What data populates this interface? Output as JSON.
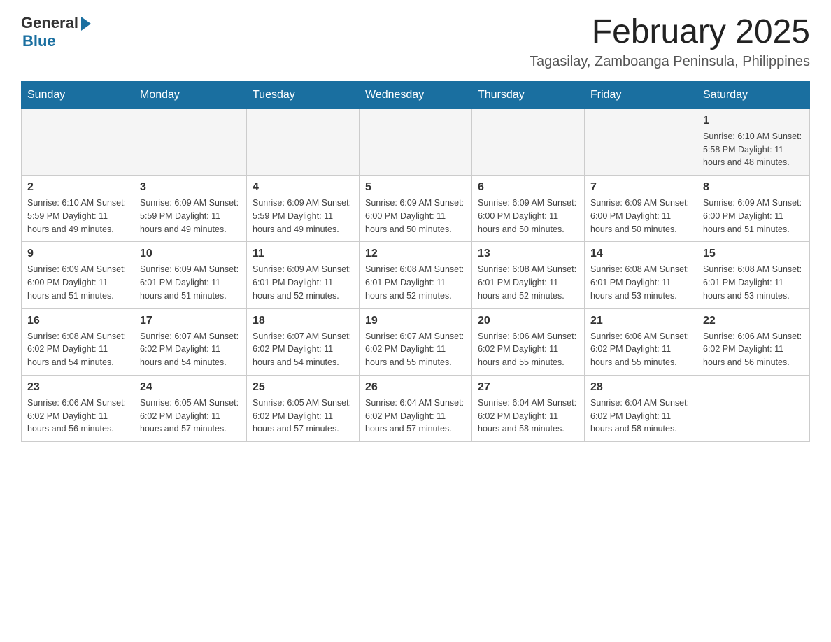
{
  "logo": {
    "general": "General",
    "blue": "Blue"
  },
  "title": "February 2025",
  "subtitle": "Tagasilay, Zamboanga Peninsula, Philippines",
  "days_of_week": [
    "Sunday",
    "Monday",
    "Tuesday",
    "Wednesday",
    "Thursday",
    "Friday",
    "Saturday"
  ],
  "weeks": [
    [
      {
        "day": "",
        "info": ""
      },
      {
        "day": "",
        "info": ""
      },
      {
        "day": "",
        "info": ""
      },
      {
        "day": "",
        "info": ""
      },
      {
        "day": "",
        "info": ""
      },
      {
        "day": "",
        "info": ""
      },
      {
        "day": "1",
        "info": "Sunrise: 6:10 AM\nSunset: 5:58 PM\nDaylight: 11 hours and 48 minutes."
      }
    ],
    [
      {
        "day": "2",
        "info": "Sunrise: 6:10 AM\nSunset: 5:59 PM\nDaylight: 11 hours and 49 minutes."
      },
      {
        "day": "3",
        "info": "Sunrise: 6:09 AM\nSunset: 5:59 PM\nDaylight: 11 hours and 49 minutes."
      },
      {
        "day": "4",
        "info": "Sunrise: 6:09 AM\nSunset: 5:59 PM\nDaylight: 11 hours and 49 minutes."
      },
      {
        "day": "5",
        "info": "Sunrise: 6:09 AM\nSunset: 6:00 PM\nDaylight: 11 hours and 50 minutes."
      },
      {
        "day": "6",
        "info": "Sunrise: 6:09 AM\nSunset: 6:00 PM\nDaylight: 11 hours and 50 minutes."
      },
      {
        "day": "7",
        "info": "Sunrise: 6:09 AM\nSunset: 6:00 PM\nDaylight: 11 hours and 50 minutes."
      },
      {
        "day": "8",
        "info": "Sunrise: 6:09 AM\nSunset: 6:00 PM\nDaylight: 11 hours and 51 minutes."
      }
    ],
    [
      {
        "day": "9",
        "info": "Sunrise: 6:09 AM\nSunset: 6:00 PM\nDaylight: 11 hours and 51 minutes."
      },
      {
        "day": "10",
        "info": "Sunrise: 6:09 AM\nSunset: 6:01 PM\nDaylight: 11 hours and 51 minutes."
      },
      {
        "day": "11",
        "info": "Sunrise: 6:09 AM\nSunset: 6:01 PM\nDaylight: 11 hours and 52 minutes."
      },
      {
        "day": "12",
        "info": "Sunrise: 6:08 AM\nSunset: 6:01 PM\nDaylight: 11 hours and 52 minutes."
      },
      {
        "day": "13",
        "info": "Sunrise: 6:08 AM\nSunset: 6:01 PM\nDaylight: 11 hours and 52 minutes."
      },
      {
        "day": "14",
        "info": "Sunrise: 6:08 AM\nSunset: 6:01 PM\nDaylight: 11 hours and 53 minutes."
      },
      {
        "day": "15",
        "info": "Sunrise: 6:08 AM\nSunset: 6:01 PM\nDaylight: 11 hours and 53 minutes."
      }
    ],
    [
      {
        "day": "16",
        "info": "Sunrise: 6:08 AM\nSunset: 6:02 PM\nDaylight: 11 hours and 54 minutes."
      },
      {
        "day": "17",
        "info": "Sunrise: 6:07 AM\nSunset: 6:02 PM\nDaylight: 11 hours and 54 minutes."
      },
      {
        "day": "18",
        "info": "Sunrise: 6:07 AM\nSunset: 6:02 PM\nDaylight: 11 hours and 54 minutes."
      },
      {
        "day": "19",
        "info": "Sunrise: 6:07 AM\nSunset: 6:02 PM\nDaylight: 11 hours and 55 minutes."
      },
      {
        "day": "20",
        "info": "Sunrise: 6:06 AM\nSunset: 6:02 PM\nDaylight: 11 hours and 55 minutes."
      },
      {
        "day": "21",
        "info": "Sunrise: 6:06 AM\nSunset: 6:02 PM\nDaylight: 11 hours and 55 minutes."
      },
      {
        "day": "22",
        "info": "Sunrise: 6:06 AM\nSunset: 6:02 PM\nDaylight: 11 hours and 56 minutes."
      }
    ],
    [
      {
        "day": "23",
        "info": "Sunrise: 6:06 AM\nSunset: 6:02 PM\nDaylight: 11 hours and 56 minutes."
      },
      {
        "day": "24",
        "info": "Sunrise: 6:05 AM\nSunset: 6:02 PM\nDaylight: 11 hours and 57 minutes."
      },
      {
        "day": "25",
        "info": "Sunrise: 6:05 AM\nSunset: 6:02 PM\nDaylight: 11 hours and 57 minutes."
      },
      {
        "day": "26",
        "info": "Sunrise: 6:04 AM\nSunset: 6:02 PM\nDaylight: 11 hours and 57 minutes."
      },
      {
        "day": "27",
        "info": "Sunrise: 6:04 AM\nSunset: 6:02 PM\nDaylight: 11 hours and 58 minutes."
      },
      {
        "day": "28",
        "info": "Sunrise: 6:04 AM\nSunset: 6:02 PM\nDaylight: 11 hours and 58 minutes."
      },
      {
        "day": "",
        "info": ""
      }
    ]
  ]
}
